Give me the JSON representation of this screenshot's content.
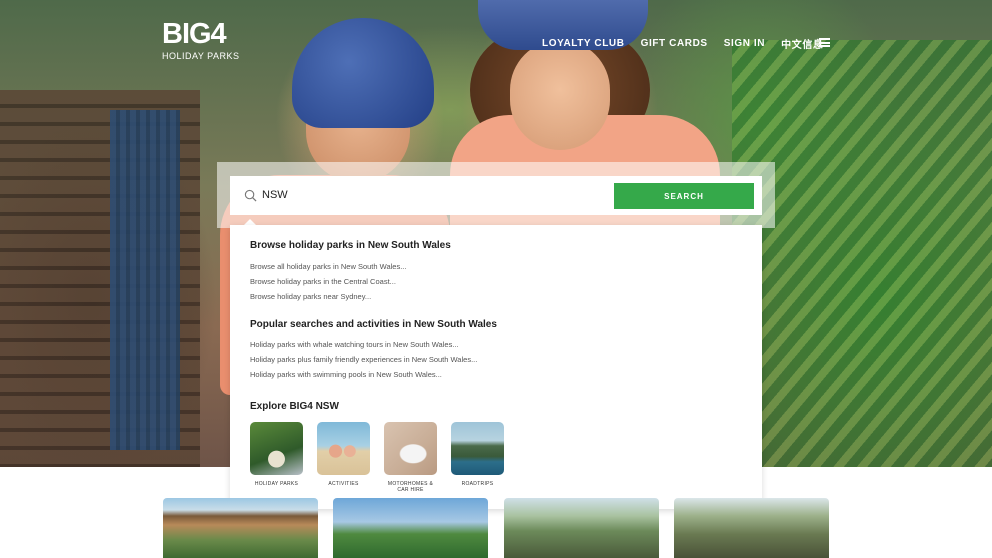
{
  "brand": {
    "logo_main": "BIG4",
    "logo_sub": "HOLIDAY PARKS"
  },
  "nav": {
    "items": [
      "LOYALTY CLUB",
      "GIFT CARDS",
      "SIGN IN",
      "中文信息"
    ]
  },
  "search": {
    "value": "NSW",
    "button_label": "SEARCH"
  },
  "dropdown": {
    "sections": [
      {
        "title": "Browse holiday parks in New South Wales",
        "links": [
          "Browse all holiday parks in New South Wales...",
          "Browse holiday parks in the Central Coast...",
          "Browse holiday parks near Sydney..."
        ]
      },
      {
        "title": "Popular searches and activities in New South Wales",
        "links": [
          "Holiday parks with whale watching tours in New South Wales...",
          "Holiday parks plus family friendly experiences in New South Wales...",
          "Holiday parks with swimming pools in New South Wales..."
        ]
      }
    ],
    "explore": {
      "title": "Explore BIG4 NSW",
      "tiles": [
        {
          "label": "HOLIDAY PARKS"
        },
        {
          "label": "ACTIVITIES"
        },
        {
          "label": "MOTORHOMES & CAR HIRE"
        },
        {
          "label": "ROADTRIPS"
        }
      ]
    }
  },
  "colors": {
    "accent": "#35a94a"
  }
}
